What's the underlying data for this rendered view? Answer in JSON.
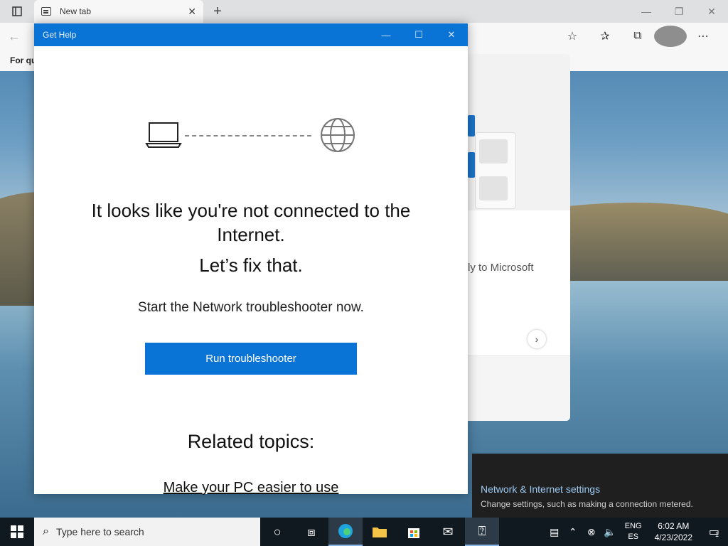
{
  "browser": {
    "tab_title": "New tab",
    "favorites_bar_text": "For qu"
  },
  "ntp": {
    "partial_text": "ly to Microsoft"
  },
  "get_help": {
    "window_title": "Get Help",
    "heading": "It looks like you're not connected to the Internet.",
    "subheading": "Let’s fix that.",
    "description": "Start the Network troubleshooter now.",
    "button_label": "Run troubleshooter",
    "related_heading": "Related topics:",
    "related_link": "Make your PC easier to use"
  },
  "network_flyout": {
    "link": "Network & Internet settings",
    "description": "Change settings, such as making a connection metered."
  },
  "taskbar": {
    "search_placeholder": "Type here to search",
    "lang_top": "ENG",
    "lang_bottom": "ES",
    "time": "6:02 AM",
    "date": "4/23/2022",
    "notification_count": "1"
  },
  "colors": {
    "accent": "#0a74d6",
    "taskbar": "#101820"
  }
}
